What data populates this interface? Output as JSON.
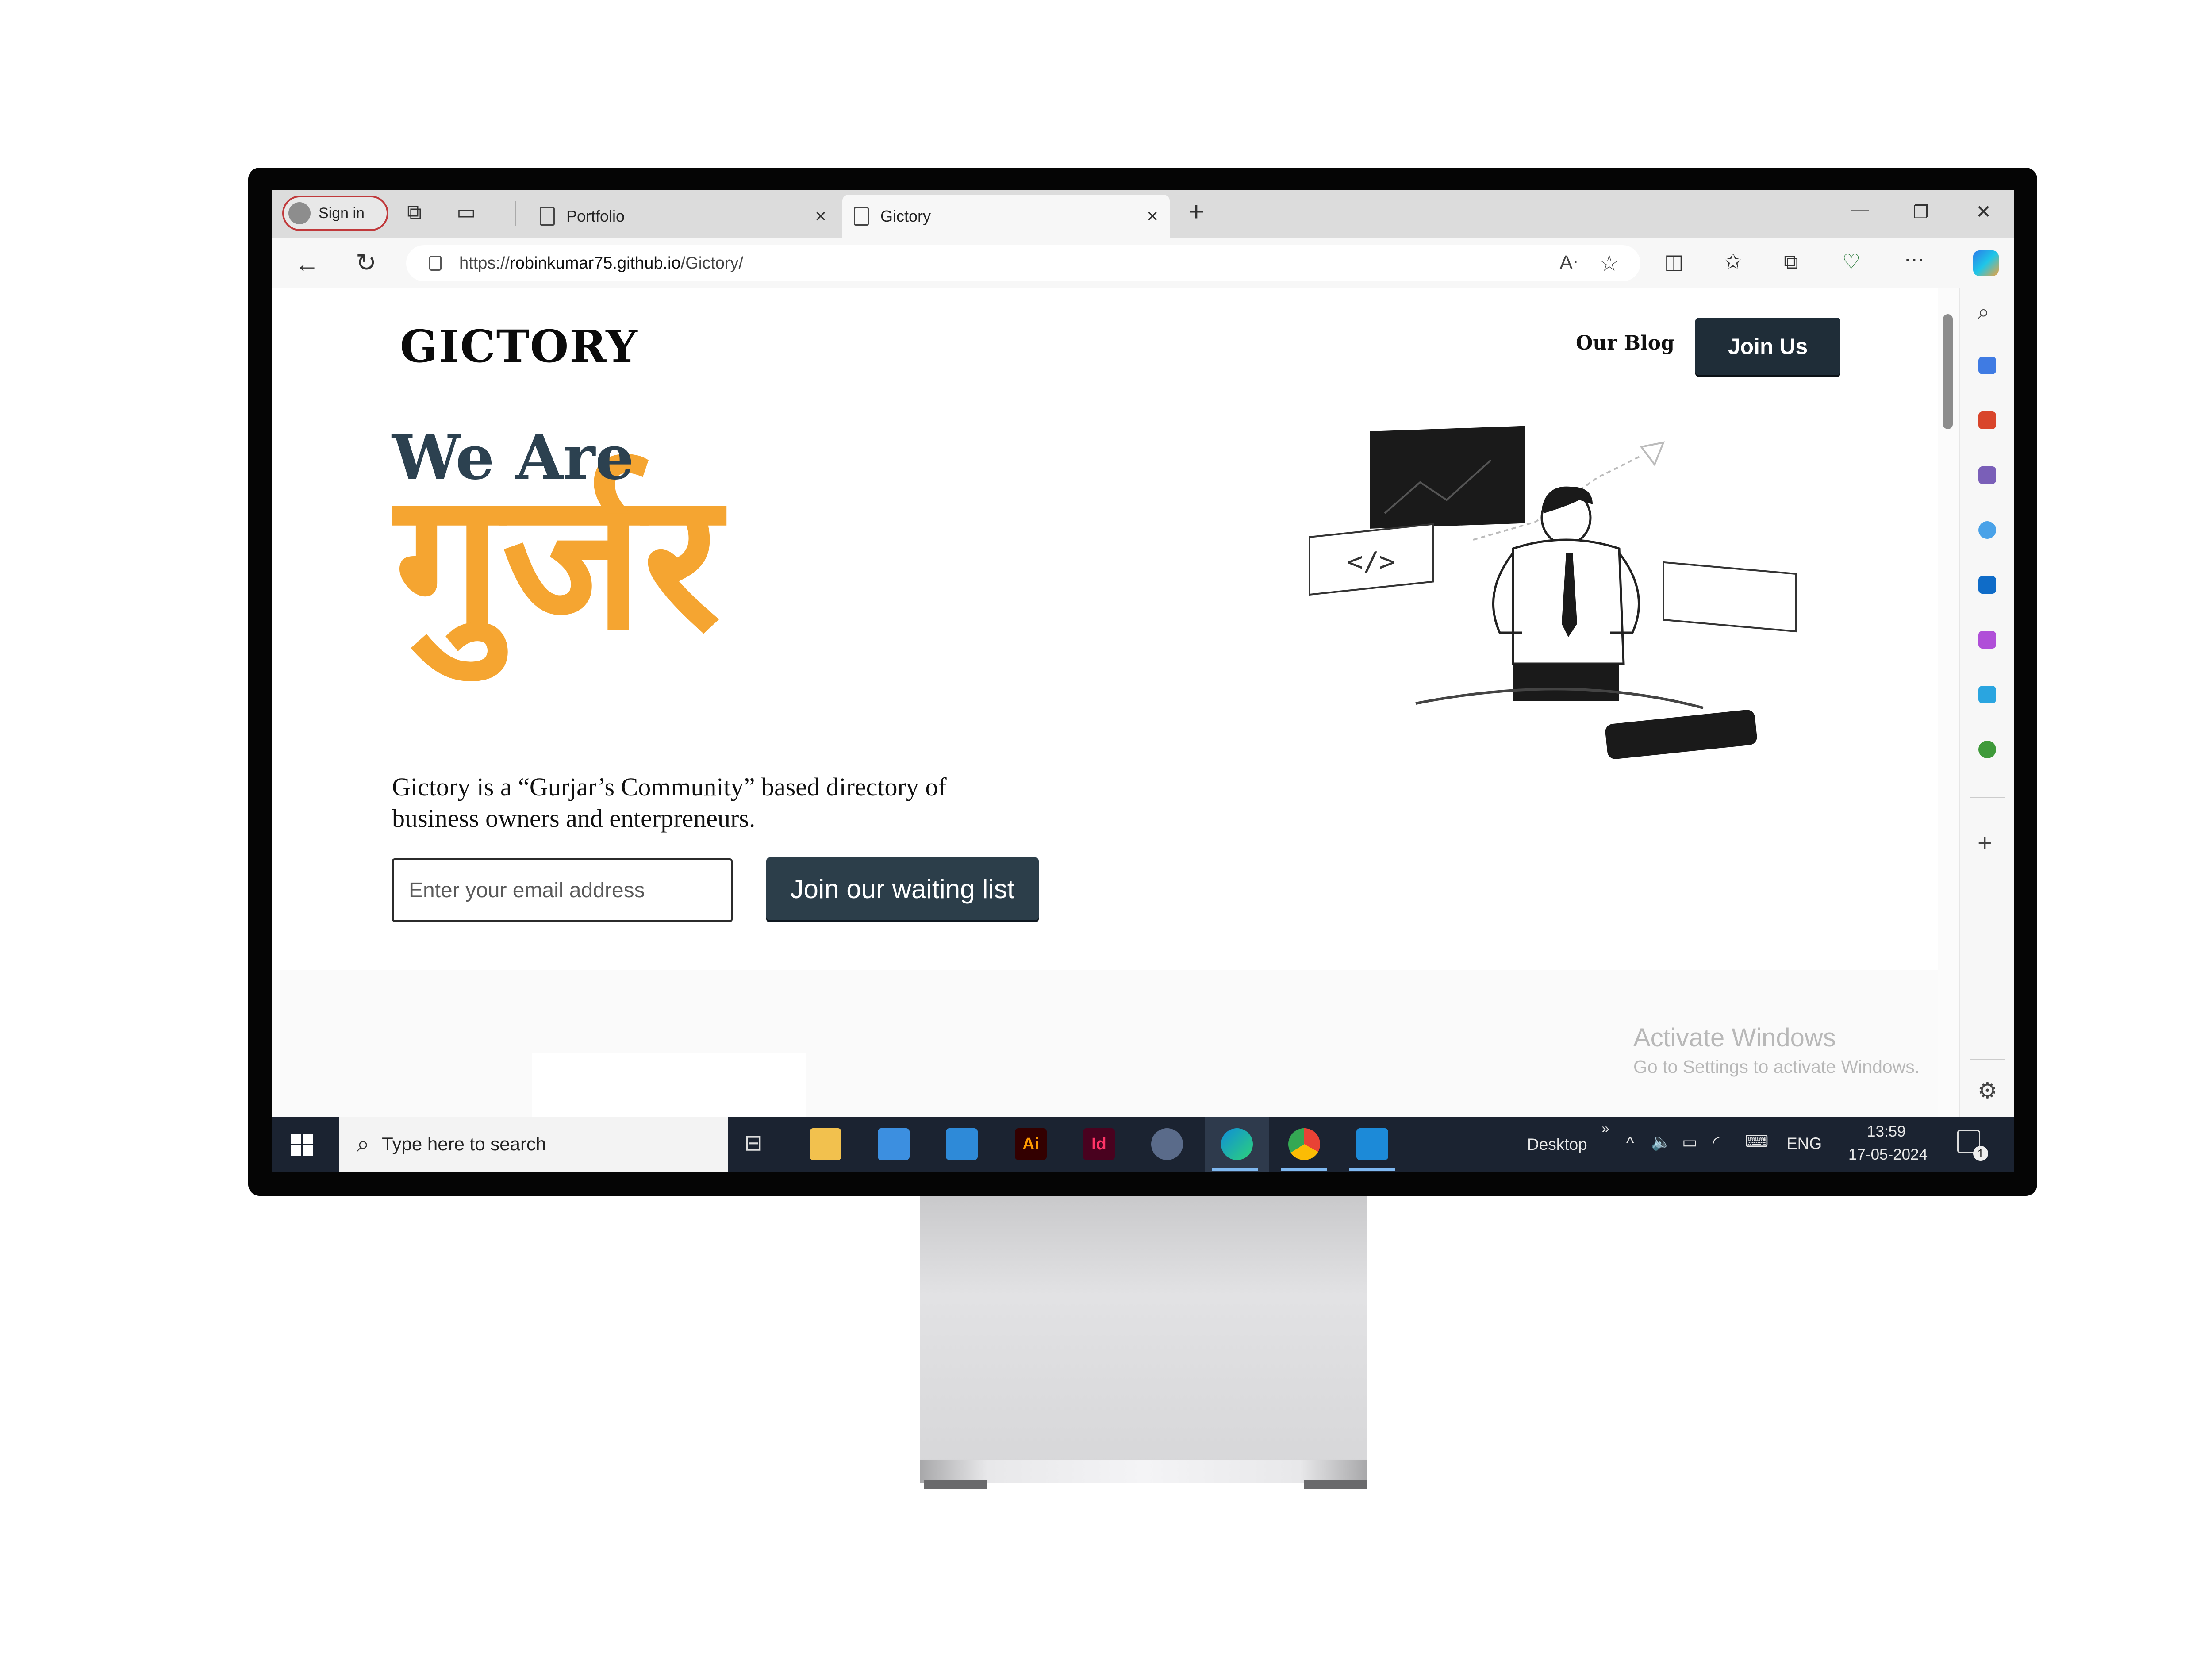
{
  "browser": {
    "signin_label": "Sign in",
    "tabs": [
      {
        "label": "Portfolio",
        "close": "×"
      },
      {
        "label": "Gictory",
        "close": "×"
      }
    ],
    "new_tab": "+",
    "window_controls": {
      "minimize": "—",
      "restore": "❐",
      "close": "✕"
    },
    "url_prefix": "https://",
    "url_host": "robinkumar75.github.io",
    "url_path": "/Gictory/",
    "nav_icons": {
      "back": "←",
      "refresh": "↻",
      "more": "⋯"
    }
  },
  "page": {
    "logo": "GICTORY",
    "nav_blog": "Our Blog",
    "nav_join": "Join Us",
    "hero_line1": "We Are",
    "hero_line2": "गुर्जर",
    "description": "Gictory is a “Gurjar’s Community” based directory of business owners and enterpreneurs.",
    "email_placeholder": "Enter your email address",
    "waitlist_button": "Join our waiting list",
    "watermark_title": "Activate Windows",
    "watermark_sub": "Go to Settings to activate Windows."
  },
  "sidebar": {
    "add": "+",
    "settings": "⚙",
    "icons": [
      "search-icon",
      "shopping-tag-icon",
      "toolbox-icon",
      "games-icon",
      "microsoft365-icon",
      "outlook-icon",
      "designer-icon",
      "telegram-icon",
      "tree-icon"
    ]
  },
  "taskbar": {
    "search_placeholder": "Type here to search",
    "desktop_label": "Desktop",
    "language": "ENG",
    "time": "13:59",
    "date": "17-05-2024",
    "notification_count": "1",
    "app_labels": {
      "illustrator": "Ai",
      "indesign": "Id"
    }
  },
  "colors": {
    "accent_orange": "#f5a531",
    "heading_slate": "#2c4150",
    "button_dark": "#1f2d38",
    "taskbar_bg": "#1b2331"
  }
}
